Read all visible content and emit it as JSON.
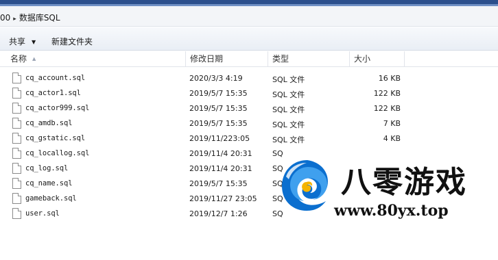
{
  "window": {
    "accent_color": "#2b4f8c"
  },
  "address_bar": {
    "prefix": "00",
    "folder": "数据库SQL"
  },
  "toolbar": {
    "share_label": "共享",
    "new_folder_label": "新建文件夹"
  },
  "columns": {
    "name": "名称",
    "date": "修改日期",
    "type": "类型",
    "size": "大小"
  },
  "files": [
    {
      "name": "cq_account.sql",
      "date": "2020/3/3 4:19",
      "type": "SQL 文件",
      "size": "16 KB"
    },
    {
      "name": "cq_actor1.sql",
      "date": "2019/5/7 15:35",
      "type": "SQL 文件",
      "size": "122 KB"
    },
    {
      "name": "cq_actor999.sql",
      "date": "2019/5/7 15:35",
      "type": "SQL 文件",
      "size": "122 KB"
    },
    {
      "name": "cq_amdb.sql",
      "date": "2019/5/7 15:35",
      "type": "SQL 文件",
      "size": "7 KB"
    },
    {
      "name": "cq_gstatic.sql",
      "date": "2019/11/2​23:05",
      "type": "SQL 文件",
      "size": "4 KB"
    },
    {
      "name": "cq_locallog.sql",
      "date": "2019/11/4 20:31",
      "type": "SQ",
      "size": ""
    },
    {
      "name": "cq_log.sql",
      "date": "2019/11/4 20:31",
      "type": "SQ",
      "size": ""
    },
    {
      "name": "cq_name.sql",
      "date": "2019/5/7 15:35",
      "type": "SQ",
      "size": ""
    },
    {
      "name": "gameback.sql",
      "date": "2019/11/27 23:05",
      "type": "SQ",
      "size": ""
    },
    {
      "name": "user.sql",
      "date": "2019/12/7 1:26",
      "type": "SQ",
      "size": ""
    }
  ],
  "watermark": {
    "title": "八零游戏",
    "url": "www.80yx.top",
    "logo_colors": [
      "#0b6fcf",
      "#3fa0ee",
      "#f5b400",
      "#ffffff"
    ]
  }
}
